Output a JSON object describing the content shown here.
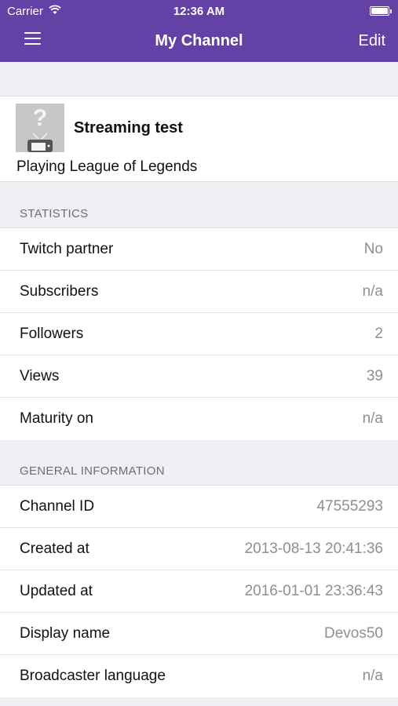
{
  "status_bar": {
    "carrier": "Carrier",
    "time": "12:36 AM"
  },
  "nav": {
    "title": "My Channel",
    "edit_label": "Edit"
  },
  "channel": {
    "name": "Streaming test",
    "status": "Playing League of Legends"
  },
  "statistics": {
    "header": "STATISTICS",
    "rows": [
      {
        "label": "Twitch partner",
        "value": "No"
      },
      {
        "label": "Subscribers",
        "value": "n/a"
      },
      {
        "label": "Followers",
        "value": "2"
      },
      {
        "label": "Views",
        "value": "39"
      },
      {
        "label": "Maturity on",
        "value": "n/a"
      }
    ]
  },
  "general": {
    "header": "GENERAL INFORMATION",
    "rows": [
      {
        "label": "Channel ID",
        "value": "47555293"
      },
      {
        "label": "Created at",
        "value": "2013-08-13 20:41:36"
      },
      {
        "label": "Updated at",
        "value": "2016-01-01 23:36:43"
      },
      {
        "label": "Display name",
        "value": "Devos50"
      },
      {
        "label": "Broadcaster language",
        "value": "n/a"
      }
    ]
  },
  "icons": {
    "menu": "hamburger-menu-icon",
    "wifi": "wifi-icon",
    "battery": "battery-icon",
    "avatar": "placeholder-tv-question-icon"
  },
  "colors": {
    "accent": "#6441a5",
    "background": "#efeff4",
    "value_text": "#8e8e93"
  }
}
